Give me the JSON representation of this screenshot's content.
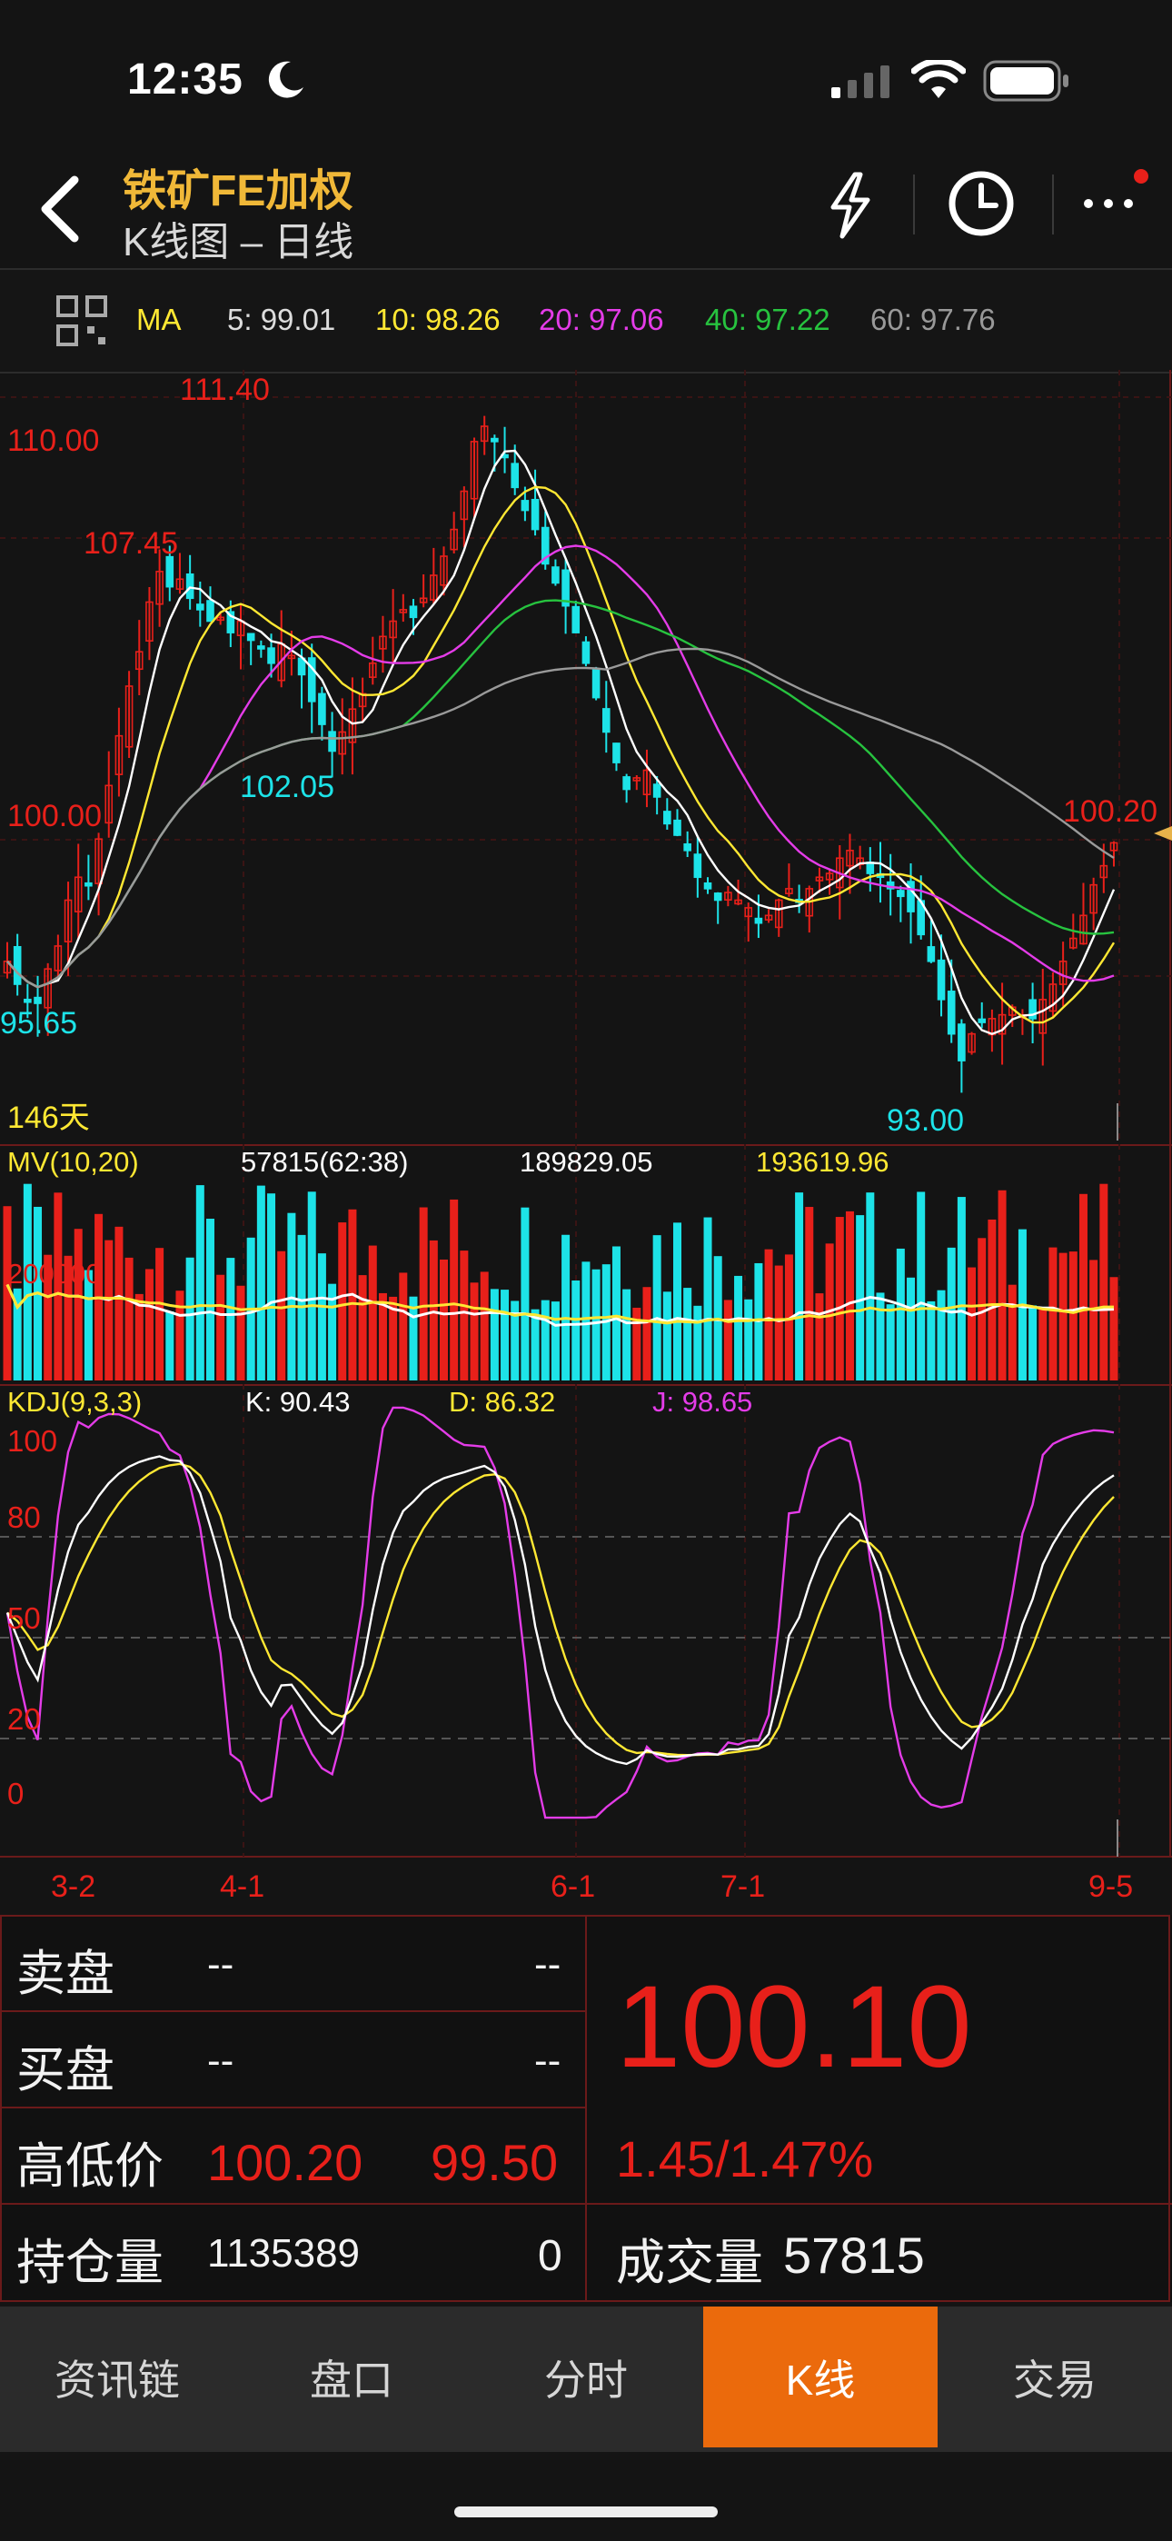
{
  "status_bar": {
    "time": "12:35"
  },
  "header": {
    "title": "铁矿FE加权",
    "subtitle": "K线图 – 日线"
  },
  "ma_bar": {
    "label": "MA",
    "ma5": "5: 99.01",
    "ma10": "10: 98.26",
    "ma20": "20: 97.06",
    "ma40": "40: 97.22",
    "ma60": "60: 97.76"
  },
  "chart": {
    "high_label": "111.40",
    "label_110": "110.00",
    "label_107": "107.45",
    "label_102": "102.05",
    "label_100": "100.00",
    "label_last": "100.20",
    "label_low1": "95.65",
    "label_low2": "93.00",
    "days": "146天",
    "volume": {
      "title": "MV(10,20)",
      "v1": "57815(62:38)",
      "v2": "189829.05",
      "v3": "193619.96",
      "axis": "200000"
    },
    "kdj": {
      "title": "KDJ(9,3,3)",
      "k": "K: 90.43",
      "d": "D: 86.32",
      "j": "J: 98.65",
      "ticks": [
        "100",
        "80",
        "50",
        "20",
        "0"
      ]
    },
    "dates": [
      "3-2",
      "4-1",
      "6-1",
      "7-1",
      "9-5"
    ]
  },
  "chart_data": {
    "type": "candlestick",
    "instrument": "铁矿FE加权",
    "period": "日线",
    "dates_shown": [
      "3-2",
      "4-1",
      "6-1",
      "7-1",
      "9-5"
    ],
    "close": [
      97.0,
      96.4,
      96.0,
      95.9,
      96.8,
      97.4,
      98.6,
      99.2,
      99.0,
      100.2,
      101.6,
      102.9,
      104.2,
      105.1,
      106.4,
      107.2,
      106.8,
      107.0,
      106.5,
      106.2,
      105.9,
      106.0,
      105.6,
      105.9,
      105.4,
      105.2,
      104.8,
      105.3,
      105.0,
      104.5,
      103.8,
      103.2,
      102.5,
      103.0,
      103.6,
      104.0,
      104.8,
      105.5,
      105.9,
      106.2,
      106.0,
      106.5,
      107.1,
      107.6,
      108.3,
      109.3,
      110.6,
      111.0,
      110.6,
      110.2,
      109.4,
      108.8,
      108.3,
      107.4,
      106.9,
      106.3,
      105.6,
      104.8,
      103.9,
      103.0,
      102.2,
      101.5,
      101.8,
      102.0,
      101.3,
      100.6,
      100.3,
      99.9,
      99.2,
      98.9,
      98.6,
      98.8,
      98.6,
      98.4,
      98.0,
      98.2,
      98.6,
      98.9,
      98.6,
      98.9,
      99.2,
      99.3,
      99.7,
      99.9,
      99.7,
      99.3,
      99.2,
      98.9,
      98.7,
      98.3,
      97.7,
      97.0,
      96.0,
      95.1,
      94.4,
      95.1,
      95.4,
      95.5,
      95.6,
      95.8,
      95.6,
      95.5,
      96.0,
      96.4,
      97.0,
      97.6,
      98.2,
      99.0,
      99.5,
      100.1
    ],
    "price_levels": {
      "high": 111.4,
      "low": 93.0,
      "last": 100.2,
      "marks": [
        110.0,
        107.45,
        102.05,
        100.0,
        95.65
      ]
    },
    "ma": {
      "ma5": 99.01,
      "ma10": 98.26,
      "ma20": 97.06,
      "ma40": 97.22,
      "ma60": 97.76
    },
    "volume": {
      "mv10": 189829.05,
      "mv20": 193619.96,
      "last": 57815
    },
    "kdj": {
      "k": 90.43,
      "d": 86.32,
      "j": 98.65,
      "ylim": [
        0,
        100
      ]
    },
    "colors": {
      "up": "#e8201a",
      "down": "#1de3e8",
      "ma5": "#ffffff",
      "ma10": "#ffe833",
      "ma20": "#e43ce8",
      "ma40": "#27c33f",
      "ma60": "#9a9a9a"
    }
  },
  "quote": {
    "sell_label": "卖盘",
    "sell_v1": "--",
    "sell_v2": "--",
    "buy_label": "买盘",
    "buy_v1": "--",
    "buy_v2": "--",
    "hl_label": "高低价",
    "high": "100.20",
    "low": "99.50",
    "oi_label": "持仓量",
    "oi": "1135389",
    "oi_change": "0",
    "price": "100.10",
    "change": "1.45/1.47%",
    "vol_label": "成交量",
    "vol": "57815"
  },
  "tabs": [
    "资讯链",
    "盘口",
    "分时",
    "K线",
    "交易"
  ]
}
